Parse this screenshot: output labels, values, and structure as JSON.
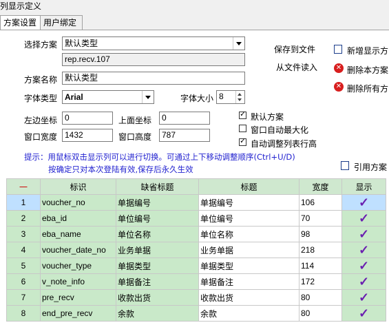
{
  "window_title": "列显示定义",
  "tabs": [
    "方案设置",
    "用户绑定"
  ],
  "form": {
    "scheme_label": "选择方案",
    "scheme_value": "默认类型",
    "scheme_source": "rep.recv.107",
    "name_label": "方案名称",
    "name_value": "默认类型",
    "font_type_label": "字体类型",
    "font_value": "Arial",
    "font_size_label": "字体大小",
    "font_size_value": "8",
    "left_label": "左边坐标",
    "left_value": "0",
    "top_label": "上面坐标",
    "top_value": "0",
    "width_label": "窗口宽度",
    "width_value": "1432",
    "height_label": "窗口高度",
    "height_value": "787"
  },
  "file_actions": {
    "save": "保存到文件",
    "load": "从文件读入"
  },
  "buttons": {
    "add": "新增显示方",
    "delete": "删除本方案",
    "delete_all": "删除所有方",
    "apply": "引用方案"
  },
  "checkboxes": [
    {
      "label": "默认方案",
      "checked": true
    },
    {
      "label": "窗口自动最大化",
      "checked": false
    },
    {
      "label": "自动调整列表行高",
      "checked": true
    }
  ],
  "hint": {
    "line1": "提示：用鼠标双击显示列可以进行切换。可通过上下移动调整顺序(Ctrl+U/D)",
    "line2": "按确定只对本次登陆有效,保存后永久生效"
  },
  "grid": {
    "headers": [
      "一",
      "标识",
      "缺省标题",
      "标题",
      "宽度",
      "显示"
    ],
    "rows": [
      {
        "n": "1",
        "id": "voucher_no",
        "def": "单据编号",
        "title": "单据编号",
        "w": "106",
        "show": true
      },
      {
        "n": "2",
        "id": "eba_id",
        "def": "单位编号",
        "title": "单位编号",
        "w": "70",
        "show": true
      },
      {
        "n": "3",
        "id": "eba_name",
        "def": "单位名称",
        "title": "单位名称",
        "w": "98",
        "show": true
      },
      {
        "n": "4",
        "id": "voucher_date_no",
        "def": "业务单据",
        "title": "业务单据",
        "w": "218",
        "show": true
      },
      {
        "n": "5",
        "id": "voucher_type",
        "def": "单据类型",
        "title": "单据类型",
        "w": "114",
        "show": true
      },
      {
        "n": "6",
        "id": "v_note_info",
        "def": "单据备注",
        "title": "单据备注",
        "w": "172",
        "show": true
      },
      {
        "n": "7",
        "id": "pre_recv",
        "def": "收款出货",
        "title": "收款出货",
        "w": "80",
        "show": true
      },
      {
        "n": "8",
        "id": "end_pre_recv",
        "def": "余款",
        "title": "余款",
        "w": "80",
        "show": true
      }
    ]
  }
}
